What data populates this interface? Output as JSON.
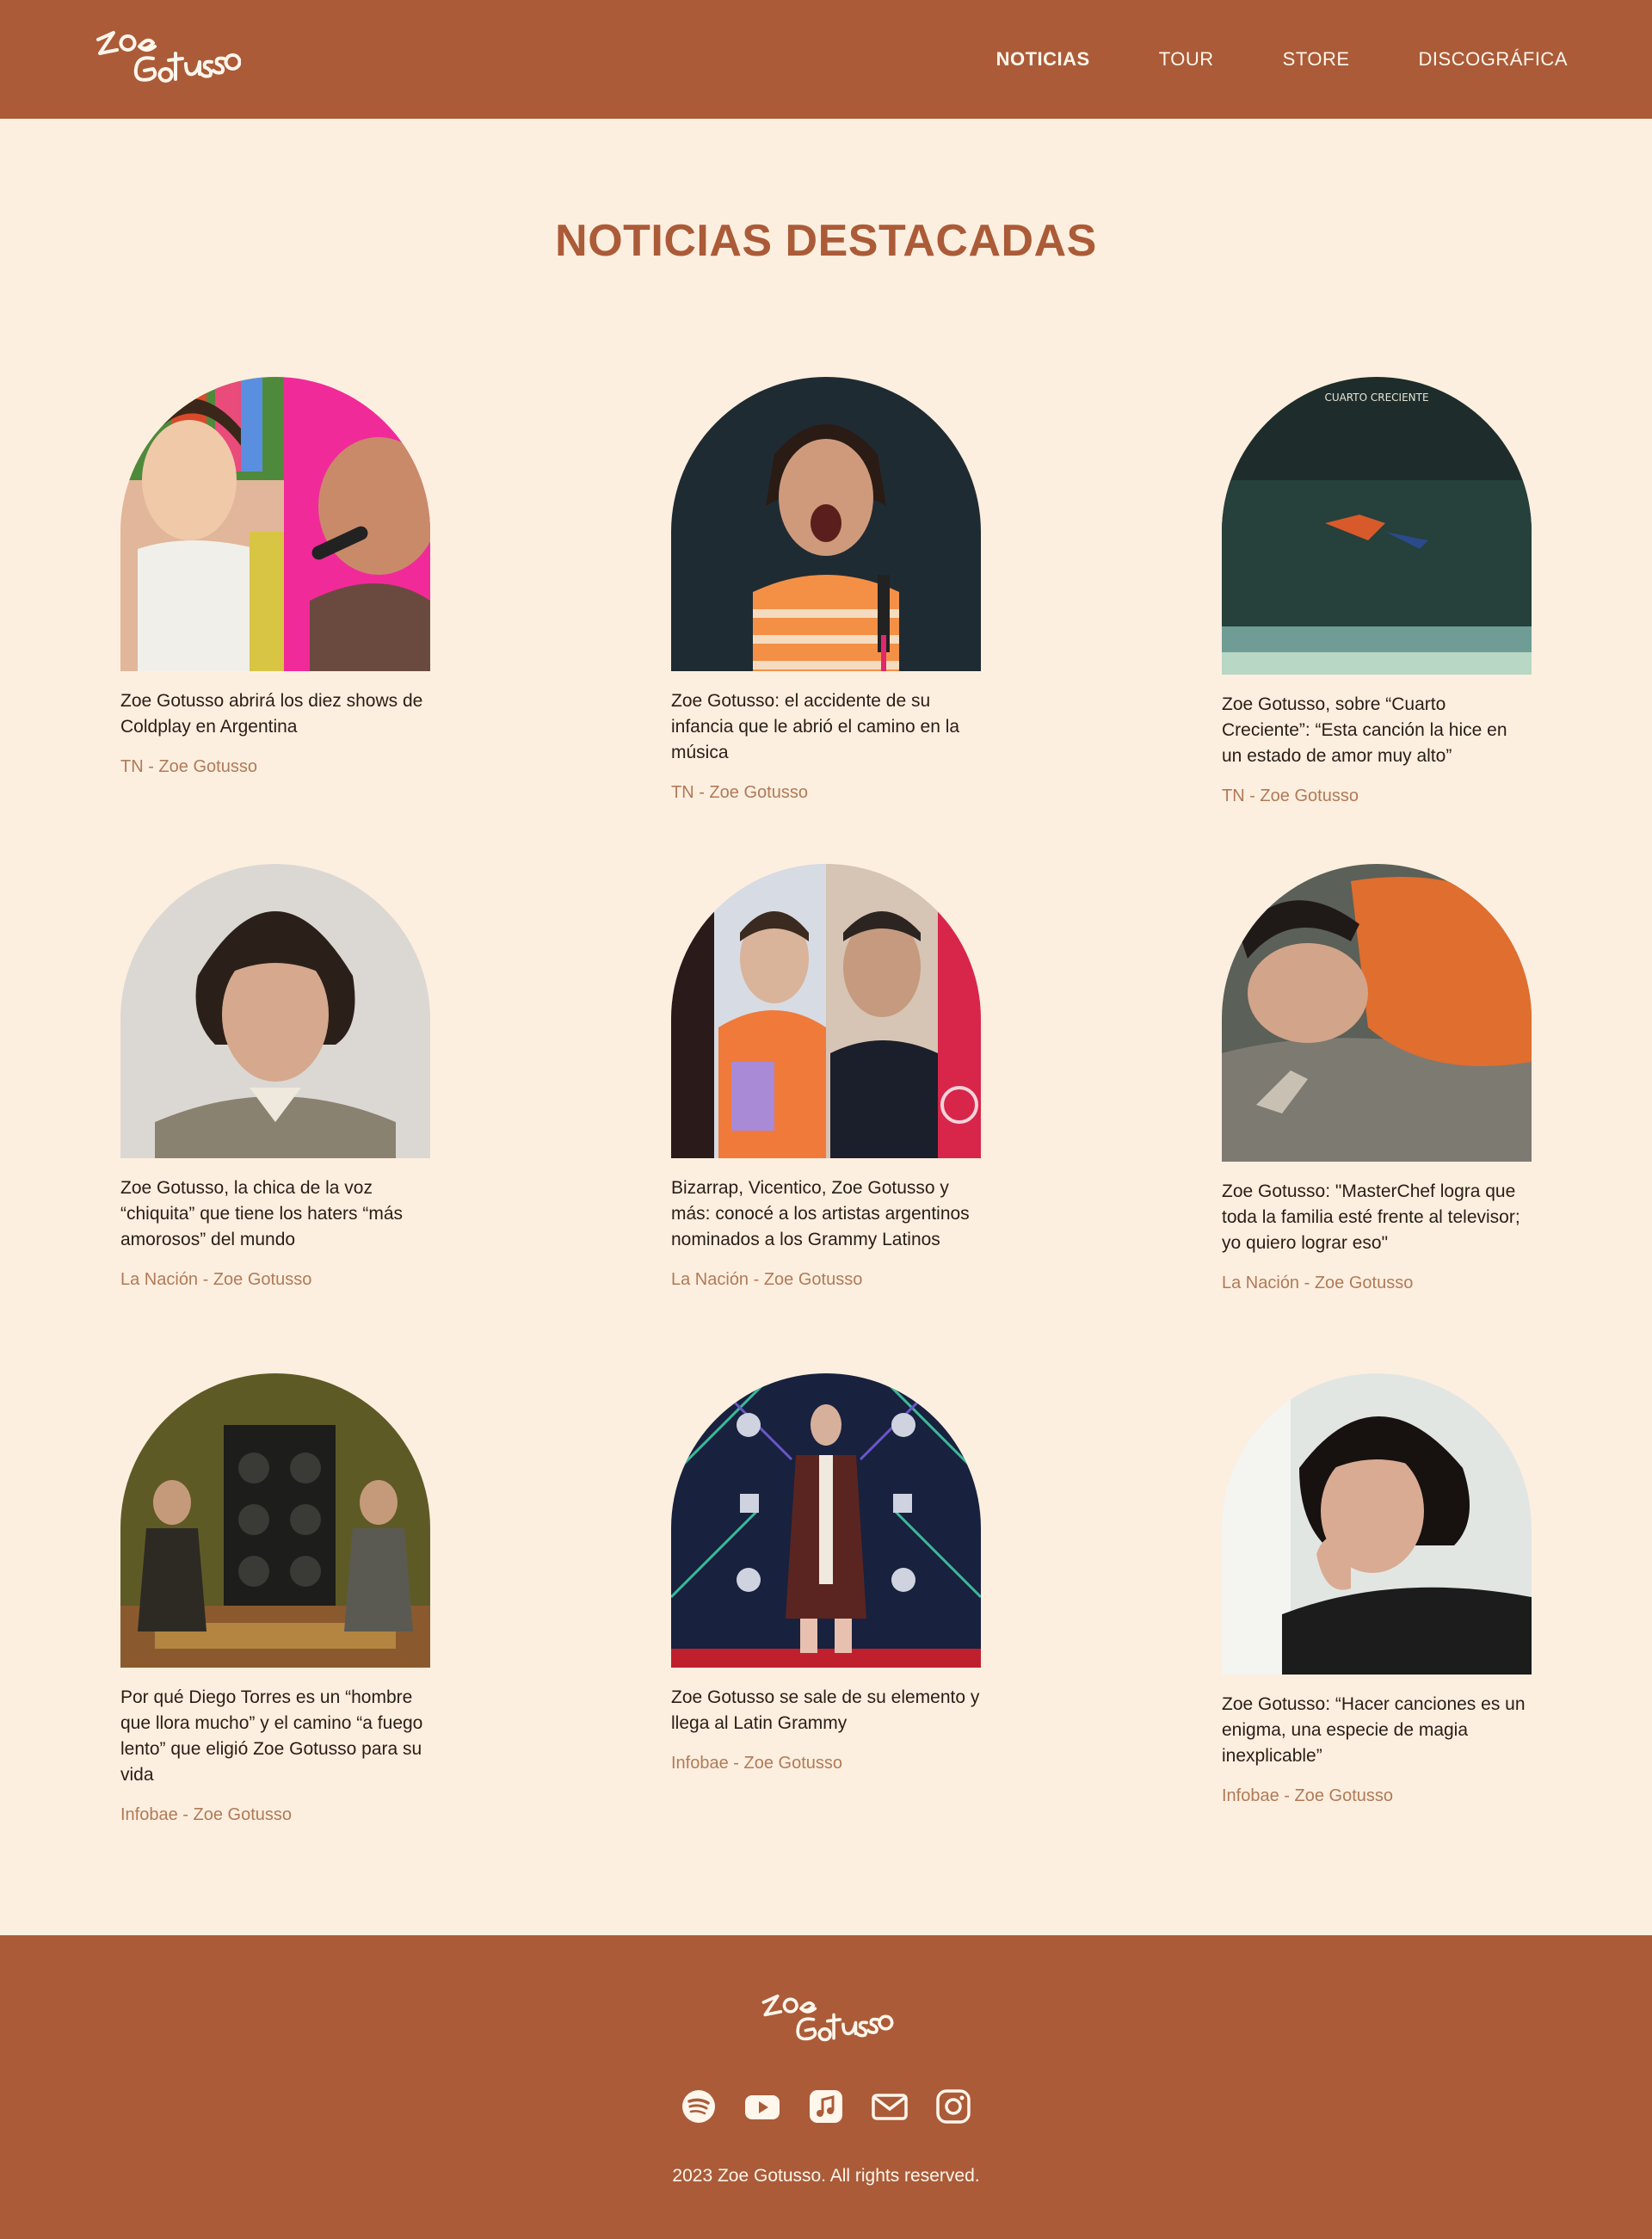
{
  "brand": {
    "logo_text": "Zoe Gotusso"
  },
  "nav": [
    {
      "label": "NOTICIAS",
      "active": true
    },
    {
      "label": "TOUR",
      "active": false
    },
    {
      "label": "STORE",
      "active": false
    },
    {
      "label": "DISCOGRÁFICA",
      "active": false
    }
  ],
  "section_title": "NOTICIAS DESTACADAS",
  "articles": [
    {
      "title": "Zoe Gotusso abrirá los diez shows de Coldplay en Argentina",
      "source": "TN - Zoe Gotusso"
    },
    {
      "title": "Zoe Gotusso: el accidente de su infancia que le abrió el camino en la música",
      "source": "TN - Zoe Gotusso"
    },
    {
      "title": "Zoe Gotusso, sobre “Cuarto Creciente”: “Esta canción la hice en un estado de amor muy alto”",
      "source": "TN - Zoe Gotusso"
    },
    {
      "title": "Zoe Gotusso, la chica de la voz “chiquita” que tiene los haters “más amorosos” del mundo",
      "source": "La Nación - Zoe Gotusso"
    },
    {
      "title": "Bizarrap, Vicentico, Zoe Gotusso y más: conocé a los artistas argentinos nominados a los Grammy Latinos",
      "source": "La Nación - Zoe Gotusso"
    },
    {
      "title": "Zoe Gotusso: \"MasterChef logra que toda la familia esté frente al televisor; yo quiero lograr eso\"",
      "source": "La Nación - Zoe Gotusso"
    },
    {
      "title": "Por qué Diego Torres es un “hombre que llora mucho” y el camino “a fuego lento” que eligió Zoe Gotusso para su vida",
      "source": "Infobae - Zoe Gotusso"
    },
    {
      "title": "Zoe Gotusso se sale de su elemento y llega al Latin Grammy",
      "source": "Infobae - Zoe Gotusso"
    },
    {
      "title": "Zoe Gotusso: “Hacer canciones es un enigma, una especie de magia inexplicable”",
      "source": "Infobae - Zoe Gotusso"
    }
  ],
  "cover_text": "CUARTO CRECIENTE",
  "footer": {
    "socials": [
      "spotify-icon",
      "youtube-icon",
      "apple-music-icon",
      "mail-icon",
      "instagram-icon"
    ],
    "copyright": "2023 Zoe Gotusso. All rights reserved."
  },
  "colors": {
    "brand": "#ab5b38",
    "background": "#fdefdf",
    "source_text": "#b07a58"
  }
}
